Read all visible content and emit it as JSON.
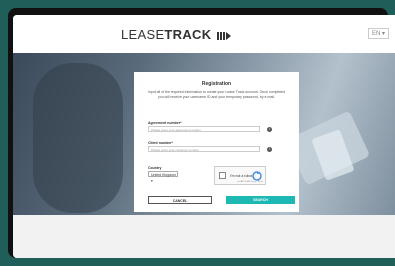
{
  "header": {
    "logo_text_light": "LEASE",
    "logo_text_bold": "TRACK",
    "language": "EN ▾"
  },
  "form": {
    "title": "Registration",
    "description": "Input all of the required information to create your Lease Track account. Once completed you will receive your username ID and your temporary password, by e-mail.",
    "agreement_label": "Agreement number*",
    "agreement_placeholder": "Please enter your agreement number",
    "client_label": "Client number*",
    "client_placeholder": "Please enter your customer number",
    "country_label": "Country",
    "country_value": "United Kingdom ▾",
    "captcha_label": "I'm not a robot",
    "captcha_small": "reCAPTCHA Privacy - Terms",
    "cancel_label": "CANCEL",
    "search_label": "SEARCH"
  },
  "colors": {
    "accent": "#1cb8b3",
    "frame": "#1f5e59"
  }
}
